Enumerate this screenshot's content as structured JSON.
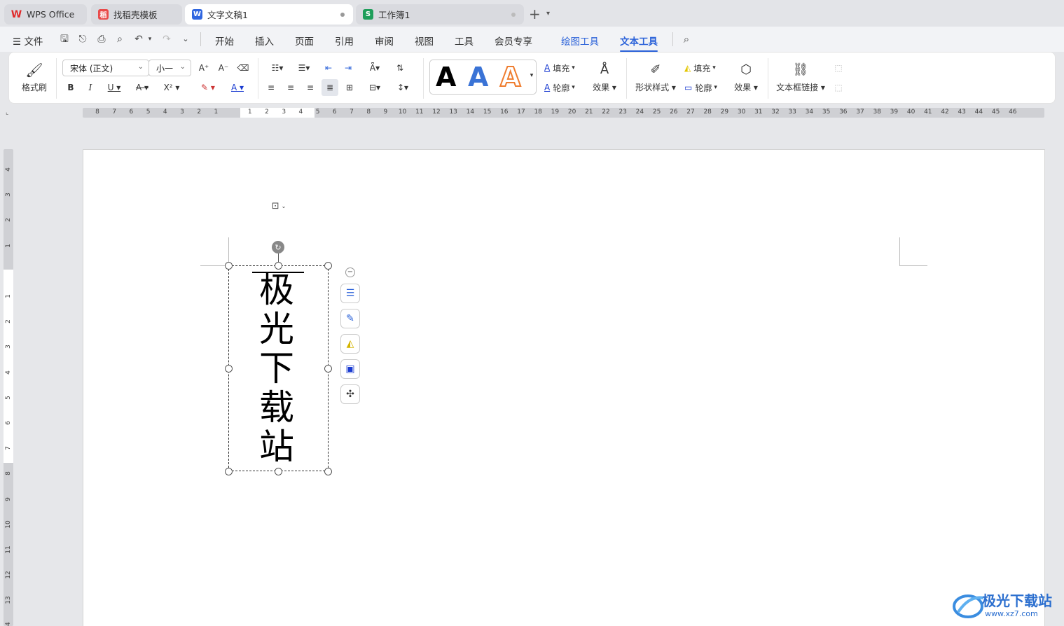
{
  "tabs": [
    {
      "label": "WPS Office"
    },
    {
      "label": "找稻壳模板"
    },
    {
      "label": "文字文稿1"
    },
    {
      "label": "工作簿1"
    }
  ],
  "menu": {
    "file": "文件",
    "items": [
      "开始",
      "插入",
      "页面",
      "引用",
      "审阅",
      "视图",
      "工具",
      "会员专享"
    ],
    "context_tabs": [
      "绘图工具",
      "文本工具"
    ]
  },
  "ribbon": {
    "format_painter": "格式刷",
    "font_name": "宋体 (正文)",
    "font_size": "小一",
    "fill_label": "填充",
    "outline_label": "轮廓",
    "effect_label": "效果",
    "shape_style_label": "形状样式",
    "fill2_label": "填充",
    "outline2_label": "轮廓",
    "effect2_label": "效果",
    "textbox_link_label": "文本框链接",
    "text_style_letter": "A"
  },
  "ruler_h": [
    "8",
    "7",
    "6",
    "5",
    "4",
    "3",
    "2",
    "1",
    "",
    "1",
    "2",
    "3",
    "4",
    "5",
    "6",
    "7",
    "8",
    "9",
    "10",
    "11",
    "12",
    "13",
    "14",
    "15",
    "16",
    "17",
    "18",
    "19",
    "20",
    "21",
    "22",
    "23",
    "24",
    "25",
    "26",
    "27",
    "28",
    "29",
    "30",
    "31",
    "32",
    "33",
    "34",
    "35",
    "36",
    "37",
    "38",
    "39",
    "40",
    "41",
    "42",
    "43",
    "44",
    "45",
    "46"
  ],
  "ruler_v": [
    "4",
    "3",
    "2",
    "1",
    "",
    "1",
    "2",
    "3",
    "4",
    "5",
    "6",
    "7",
    "8",
    "9",
    "10",
    "11",
    "12",
    "13",
    "14"
  ],
  "document": {
    "vertical_text": [
      "极",
      "光",
      "下",
      "载",
      "站"
    ]
  },
  "watermark": {
    "title": "极光下载站",
    "url": "www.xz7.com"
  }
}
